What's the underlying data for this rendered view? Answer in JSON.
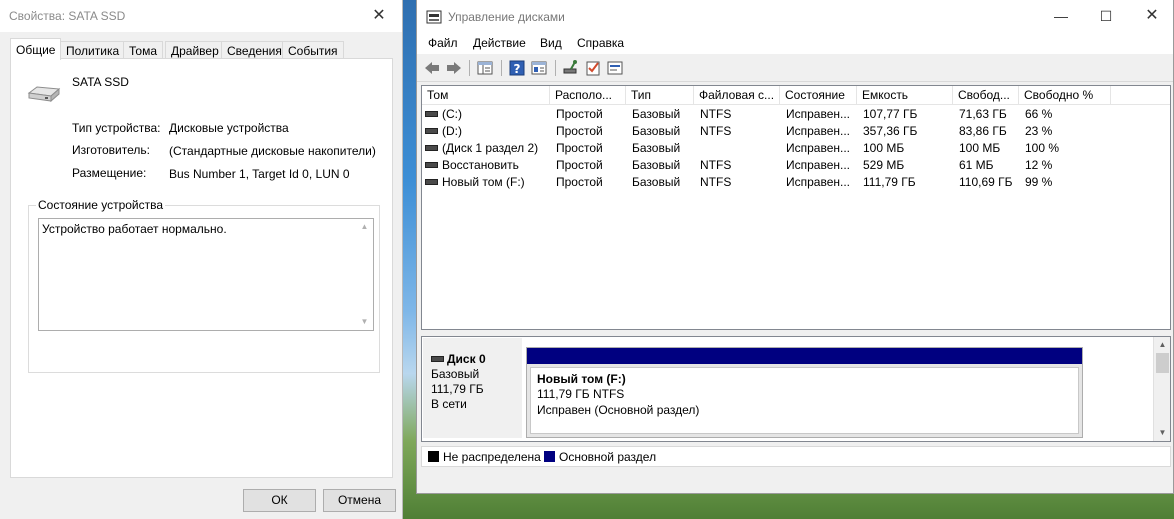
{
  "props": {
    "title": "Свойства: SATA SSD",
    "tabs": [
      "Общие",
      "Политика",
      "Тома",
      "Драйвер",
      "Сведения",
      "События"
    ],
    "device_name": "SATA SSD",
    "fields": [
      {
        "label": "Тип устройства:",
        "value": "Дисковые устройства"
      },
      {
        "label": "Изготовитель:",
        "value": "(Стандартные дисковые накопители)"
      },
      {
        "label": "Размещение:",
        "value": "Bus Number 1, Target Id 0, LUN 0"
      }
    ],
    "status_group_label": "Состояние устройства",
    "status_text": "Устройство работает нормально.",
    "ok_label": "ОК",
    "cancel_label": "Отмена"
  },
  "dm": {
    "title": "Управление дисками",
    "menu": [
      "Файл",
      "Действие",
      "Вид",
      "Справка"
    ],
    "columns": [
      "Том",
      "Располо...",
      "Тип",
      "Файловая с...",
      "Состояние",
      "Емкость",
      "Свобод...",
      "Свободно %"
    ],
    "rows": [
      [
        "(C:)",
        "Простой",
        "Базовый",
        "NTFS",
        "Исправен...",
        "107,77 ГБ",
        "71,63 ГБ",
        "66 %"
      ],
      [
        "(D:)",
        "Простой",
        "Базовый",
        "NTFS",
        "Исправен...",
        "357,36 ГБ",
        "83,86 ГБ",
        "23 %"
      ],
      [
        "(Диск 1 раздел 2)",
        "Простой",
        "Базовый",
        "",
        "Исправен...",
        "100 МБ",
        "100 МБ",
        "100 %"
      ],
      [
        "Восстановить",
        "Простой",
        "Базовый",
        "NTFS",
        "Исправен...",
        "529 МБ",
        "61 МБ",
        "12 %"
      ],
      [
        "Новый том (F:)",
        "Простой",
        "Базовый",
        "NTFS",
        "Исправен...",
        "111,79 ГБ",
        "110,69 ГБ",
        "99 %"
      ]
    ],
    "disk": {
      "name": "Диск 0",
      "type": "Базовый",
      "size": "111,79 ГБ",
      "state": "В сети"
    },
    "partition": {
      "name": "Новый том  (F:)",
      "size_fs": "111,79 ГБ NTFS",
      "status": "Исправен (Основной раздел)",
      "color": "#000080"
    },
    "legend": [
      {
        "label": "Не распределена",
        "color": "#000000"
      },
      {
        "label": "Основной раздел",
        "color": "#000080"
      }
    ]
  }
}
